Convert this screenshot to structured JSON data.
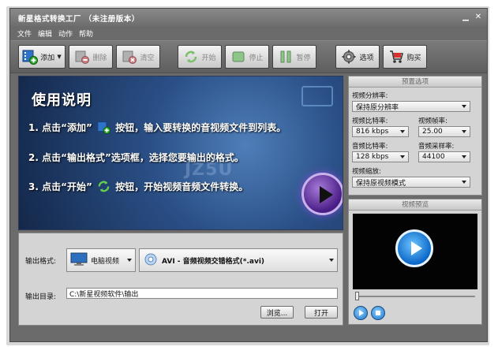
{
  "window": {
    "title": "新星格式转换工厂 （未注册版本）"
  },
  "menu": [
    "文件",
    "编辑",
    "动作",
    "帮助"
  ],
  "toolbar": {
    "add": "添加",
    "delete": "删除",
    "clear": "清空",
    "start": "开始",
    "stop": "停止",
    "pause": "暂停",
    "options": "选项",
    "buy": "购买"
  },
  "banner": {
    "title": "使用说明",
    "step1_a": "1. 点击“添加”",
    "step1_b": "按钮，输入要转换的音视频文件到列表。",
    "step2": "2. 点击“输出格式”选项框，选择您要输出的格式。",
    "step3_a": "3. 点击“开始”",
    "step3_b": "按钮，开始视频音频文件转换。"
  },
  "output": {
    "format_label": "输出格式:",
    "category": "电脑视频",
    "format": "AVI - 音频视频交错格式(*.avi)",
    "dir_label": "输出目录:",
    "dir_value": "C:\\新星视频软件\\输出",
    "browse": "浏览...",
    "open": "打开"
  },
  "settings": {
    "header": "预置选项",
    "resolution_label": "视频分辨率:",
    "resolution_value": "保持原分辨率",
    "vbitrate_label": "视频比特率:",
    "vbitrate_value": "816 kbps",
    "framerate_label": "视频帧率:",
    "framerate_value": "25.00",
    "abitrate_label": "音频比特率:",
    "abitrate_value": "128 kbps",
    "samplerate_label": "音频采样率:",
    "samplerate_value": "44100",
    "scale_label": "视频缩放:",
    "scale_value": "保持原视频模式"
  },
  "preview": {
    "header": "视频预览"
  },
  "colors": {
    "accent": "#4a1d86",
    "window_bg": "#6b6b6b",
    "panel_bg": "#d4d4d4"
  }
}
